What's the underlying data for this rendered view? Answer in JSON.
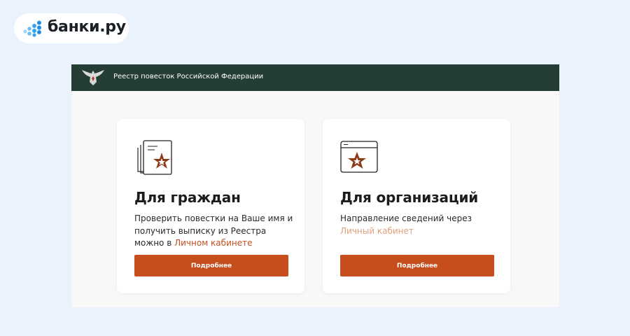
{
  "brand": {
    "name": "банки.ру"
  },
  "header": {
    "title": "Реестр повесток Российской Федерации"
  },
  "cards": [
    {
      "title": "Для граждан",
      "text_before": "Проверить повестки на Ваше имя и получить выписку из Реестра можно в ",
      "link": "Личном кабинете",
      "button": "Подробнее",
      "icon": "document-star-icon"
    },
    {
      "title": "Для организаций",
      "text_before": "Направление сведений через ",
      "link": "Личный кабинет",
      "button": "Подробнее",
      "icon": "browser-window-star-icon"
    }
  ],
  "colors": {
    "page_background": "#eaf3fd",
    "header_background": "#243d35",
    "accent": "#c64d1c",
    "brand_dots": "#3aa3f0",
    "star": "#8c3a18"
  }
}
